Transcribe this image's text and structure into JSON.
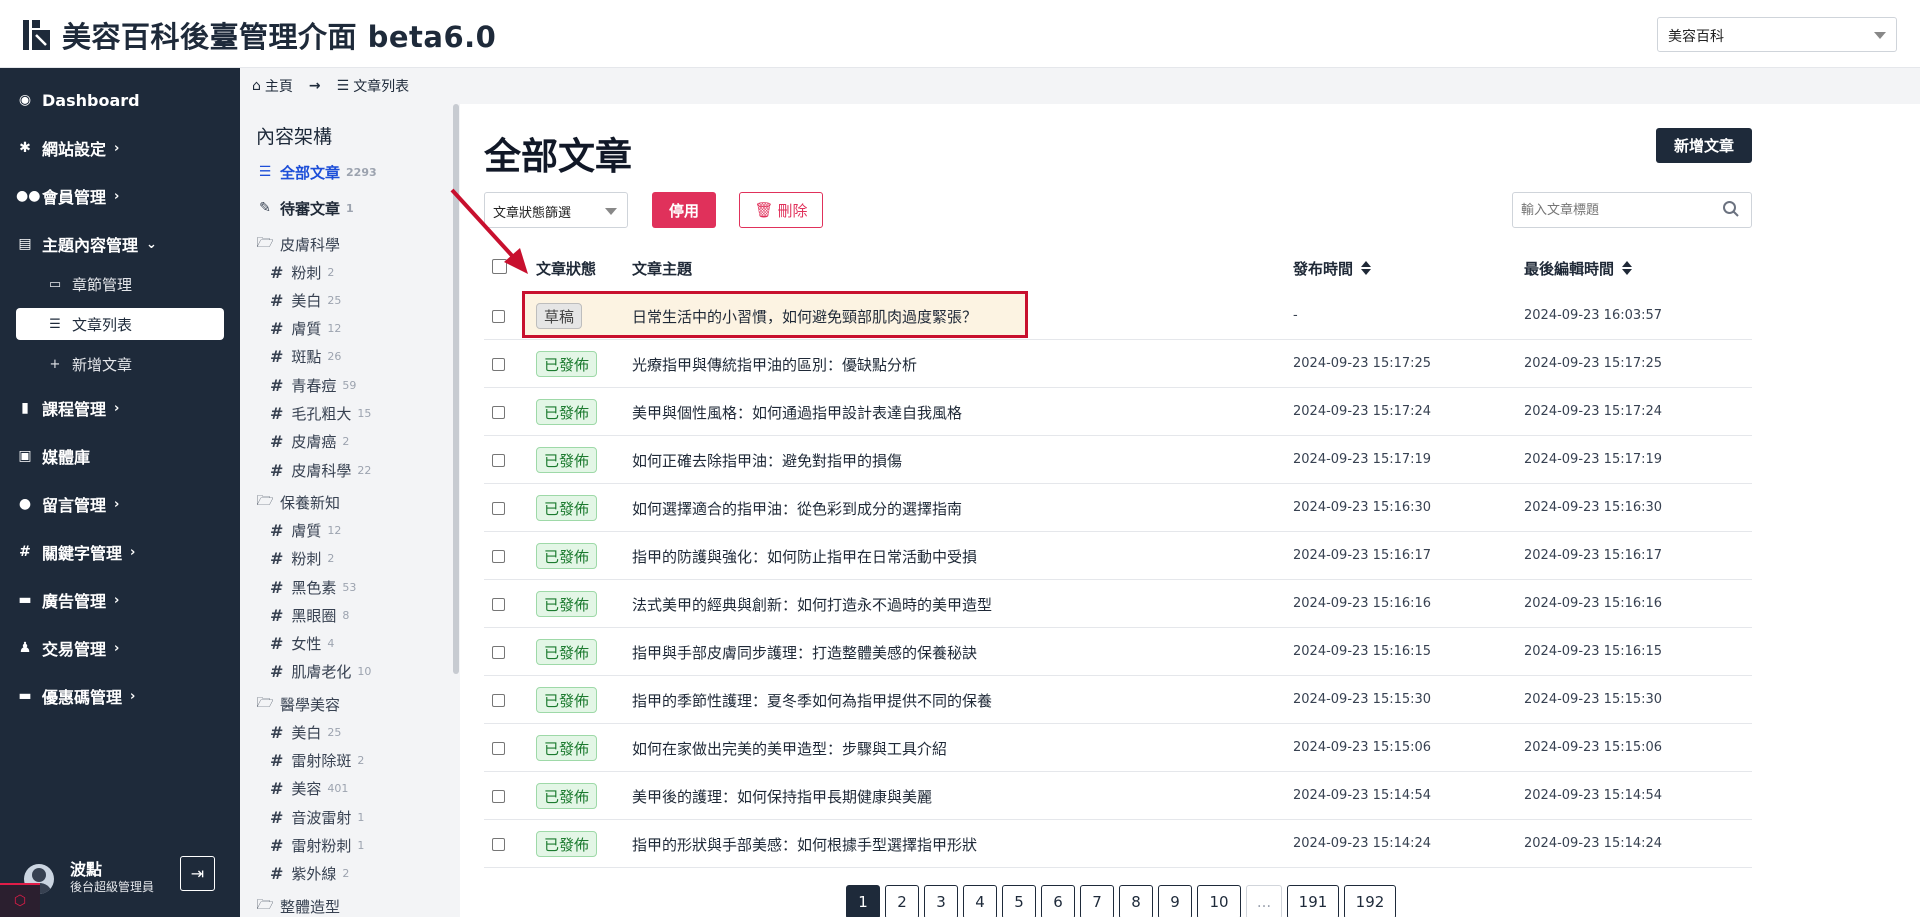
{
  "header": {
    "title": "美容百科後臺管理介面 beta6.0",
    "site_select": "美容百科"
  },
  "sidebar": {
    "items": [
      {
        "label": "Dashboard",
        "icon": "palette-icon",
        "chevron": ""
      },
      {
        "label": "網站設定",
        "icon": "gear-icon",
        "chevron": "›"
      },
      {
        "label": "會員管理",
        "icon": "users-icon",
        "chevron": "›"
      },
      {
        "label": "主題內容管理",
        "icon": "storage-icon",
        "chevron": "⌄"
      },
      {
        "label": "課程管理",
        "icon": "book-icon",
        "chevron": "›"
      },
      {
        "label": "媒體庫",
        "icon": "images-icon",
        "chevron": ""
      },
      {
        "label": "留言管理",
        "icon": "comment-icon",
        "chevron": "›"
      },
      {
        "label": "關鍵字管理",
        "icon": "hash-icon",
        "chevron": "›"
      },
      {
        "label": "廣告管理",
        "icon": "ad-icon",
        "chevron": "›"
      },
      {
        "label": "交易管理",
        "icon": "money-bag-icon",
        "chevron": "›"
      },
      {
        "label": "優惠碼管理",
        "icon": "ticket-icon",
        "chevron": "›"
      }
    ],
    "sub_items": [
      {
        "label": "章節管理",
        "icon": "drive-icon"
      },
      {
        "label": "文章列表",
        "icon": "list-icon"
      },
      {
        "label": "新增文章",
        "icon": "plus-icon"
      }
    ],
    "user": {
      "name": "波點",
      "role": "後台超級管理員"
    }
  },
  "breadcrumb": {
    "home": "主頁",
    "current": "文章列表"
  },
  "structure": {
    "title": "內容架構",
    "all": {
      "label": "全部文章",
      "count": "2293"
    },
    "pending": {
      "label": "待審文章",
      "count": "1"
    },
    "groups": [
      {
        "label": "皮膚科學",
        "tags": [
          {
            "label": "粉刺",
            "count": "2"
          },
          {
            "label": "美白",
            "count": "25"
          },
          {
            "label": "膚質",
            "count": "12"
          },
          {
            "label": "斑點",
            "count": "26"
          },
          {
            "label": "青春痘",
            "count": "59"
          },
          {
            "label": "毛孔粗大",
            "count": "15"
          },
          {
            "label": "皮膚癌",
            "count": "2"
          },
          {
            "label": "皮膚科學",
            "count": "22"
          }
        ]
      },
      {
        "label": "保養新知",
        "tags": [
          {
            "label": "膚質",
            "count": "12"
          },
          {
            "label": "粉刺",
            "count": "2"
          },
          {
            "label": "黑色素",
            "count": "53"
          },
          {
            "label": "黑眼圈",
            "count": "8"
          },
          {
            "label": "女性",
            "count": "4"
          },
          {
            "label": "肌膚老化",
            "count": "10"
          }
        ]
      },
      {
        "label": "醫學美容",
        "tags": [
          {
            "label": "美白",
            "count": "25"
          },
          {
            "label": "雷射除斑",
            "count": "2"
          },
          {
            "label": "美容",
            "count": "401"
          },
          {
            "label": "音波雷射",
            "count": "1"
          },
          {
            "label": "雷射粉刺",
            "count": "1"
          },
          {
            "label": "紫外線",
            "count": "2"
          }
        ]
      },
      {
        "label": "整體造型",
        "tags": []
      }
    ]
  },
  "main": {
    "title": "全部文章",
    "new_button": "新增文章",
    "filter_label": "文章狀態篩選",
    "disable_button": "停用",
    "delete_button": "刪除",
    "search_placeholder": "輸入文章標題",
    "columns": {
      "status": "文章狀態",
      "subject": "文章主題",
      "publish": "發布時間",
      "edited": "最後編輯時間"
    },
    "rows": [
      {
        "status": "草稿",
        "draft": true,
        "subject": "日常生活中的小習慣，如何避免頸部肌肉過度緊張？",
        "publish": "-",
        "edited": "2024-09-23 16:03:57"
      },
      {
        "status": "已發佈",
        "subject": "光療指甲與傳統指甲油的區別：優缺點分析",
        "publish": "2024-09-23 15:17:25",
        "edited": "2024-09-23 15:17:25"
      },
      {
        "status": "已發佈",
        "subject": "美甲與個性風格：如何通過指甲設計表達自我風格",
        "publish": "2024-09-23 15:17:24",
        "edited": "2024-09-23 15:17:24"
      },
      {
        "status": "已發佈",
        "subject": "如何正確去除指甲油：避免對指甲的損傷",
        "publish": "2024-09-23 15:17:19",
        "edited": "2024-09-23 15:17:19"
      },
      {
        "status": "已發佈",
        "subject": "如何選擇適合的指甲油：從色彩到成分的選擇指南",
        "publish": "2024-09-23 15:16:30",
        "edited": "2024-09-23 15:16:30"
      },
      {
        "status": "已發佈",
        "subject": "指甲的防護與強化：如何防止指甲在日常活動中受損",
        "publish": "2024-09-23 15:16:17",
        "edited": "2024-09-23 15:16:17"
      },
      {
        "status": "已發佈",
        "subject": "法式美甲的經典與創新：如何打造永不過時的美甲造型",
        "publish": "2024-09-23 15:16:16",
        "edited": "2024-09-23 15:16:16"
      },
      {
        "status": "已發佈",
        "subject": "指甲與手部皮膚同步護理：打造整體美感的保養秘訣",
        "publish": "2024-09-23 15:16:15",
        "edited": "2024-09-23 15:16:15"
      },
      {
        "status": "已發佈",
        "subject": "指甲的季節性護理：夏冬季如何為指甲提供不同的保養",
        "publish": "2024-09-23 15:15:30",
        "edited": "2024-09-23 15:15:30"
      },
      {
        "status": "已發佈",
        "subject": "如何在家做出完美的美甲造型：步驟與工具介紹",
        "publish": "2024-09-23 15:15:06",
        "edited": "2024-09-23 15:15:06"
      },
      {
        "status": "已發佈",
        "subject": "美甲後的護理：如何保持指甲長期健康與美麗",
        "publish": "2024-09-23 15:14:54",
        "edited": "2024-09-23 15:14:54"
      },
      {
        "status": "已發佈",
        "subject": "指甲的形狀與手部美感：如何根據手型選擇指甲形狀",
        "publish": "2024-09-23 15:14:24",
        "edited": "2024-09-23 15:14:24"
      }
    ],
    "pagination": [
      "1",
      "2",
      "3",
      "4",
      "5",
      "6",
      "7",
      "8",
      "9",
      "10",
      "...",
      "191",
      "192"
    ]
  },
  "colors": {
    "sidebar": "#1e2a3a",
    "accent": "#e0315b",
    "active": "#1d4ed8",
    "annotation": "#c8102e"
  }
}
